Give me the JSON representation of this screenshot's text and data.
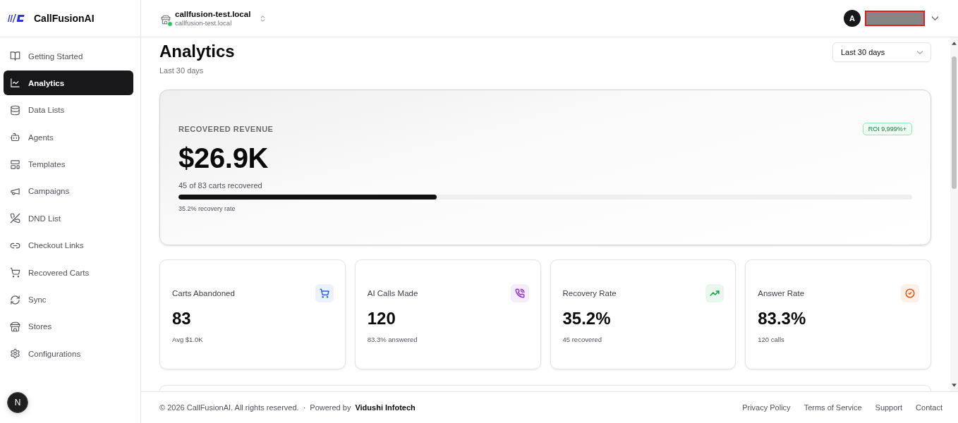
{
  "sidebar": {
    "brand": "CallFusionAI",
    "items": [
      {
        "label": "Getting Started",
        "selected": false
      },
      {
        "label": "Analytics",
        "selected": true
      },
      {
        "label": "Data Lists",
        "selected": false
      },
      {
        "label": "Agents",
        "selected": false
      },
      {
        "label": "Templates",
        "selected": false
      },
      {
        "label": "Campaigns",
        "selected": false
      },
      {
        "label": "DND List",
        "selected": false
      },
      {
        "label": "Checkout Links",
        "selected": false
      },
      {
        "label": "Recovered Carts",
        "selected": false
      },
      {
        "label": "Sync",
        "selected": false
      },
      {
        "label": "Stores",
        "selected": false
      },
      {
        "label": "Configurations",
        "selected": false
      }
    ],
    "dev_badge": "N"
  },
  "header": {
    "store": {
      "name": "callfusion-test.local",
      "domain": "callfusion-test.local",
      "online": true
    },
    "avatar": "A"
  },
  "page": {
    "title": "Analytics",
    "subtitle": "Last 30 days",
    "range": "Last 30 days"
  },
  "revenue": {
    "label": "RECOVERED REVENUE",
    "badge": "ROI 9,999%+",
    "amount": "$26.9K",
    "detail": "45 of 83 carts recovered",
    "level": 0.352,
    "caption": "35.2% recovery rate"
  },
  "stats": [
    {
      "label": "Carts Abandoned",
      "value": "83",
      "caption": "Avg $1.0K",
      "color": "#2563eb"
    },
    {
      "label": "AI Calls Made",
      "value": "120",
      "caption": "83.3% answered",
      "color": "#9333ea"
    },
    {
      "label": "Recovery Rate",
      "value": "35.2%",
      "caption": "45 recovered",
      "color": "#16a34a"
    },
    {
      "label": "Answer Rate",
      "value": "83.3%",
      "caption": "120 calls",
      "color": "#ea580c"
    }
  ],
  "footer": {
    "copyright": "© 2026 CallFusionAI. All rights reserved.",
    "separator": "·",
    "powered_by": "Powered by",
    "vendor": "Vidushi Infotech",
    "links": [
      "Privacy Policy",
      "Terms of Service",
      "Support",
      "Contact"
    ]
  }
}
